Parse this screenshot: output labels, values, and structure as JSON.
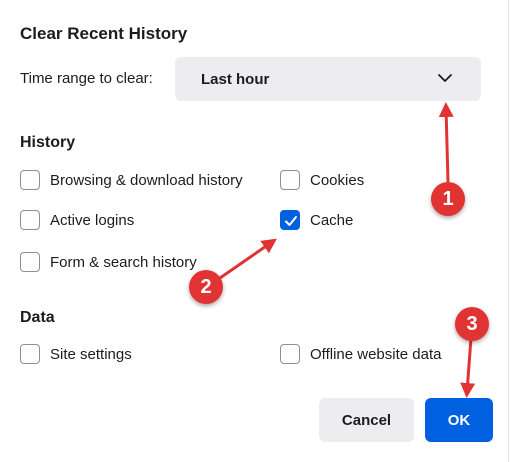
{
  "dialog": {
    "title": "Clear Recent History",
    "time_range": {
      "label": "Time range to clear:",
      "selected": "Last hour",
      "icon": "chevron-down-icon"
    },
    "history": {
      "heading": "History",
      "options": [
        {
          "label": "Browsing & download history",
          "checked": false
        },
        {
          "label": "Cookies",
          "checked": false
        },
        {
          "label": "Active logins",
          "checked": false
        },
        {
          "label": "Cache",
          "checked": true
        },
        {
          "label": "Form & search history",
          "checked": false
        }
      ]
    },
    "data": {
      "heading": "Data",
      "options": [
        {
          "label": "Site settings",
          "checked": false
        },
        {
          "label": "Offline website data",
          "checked": false
        }
      ]
    },
    "buttons": {
      "cancel": "Cancel",
      "ok": "OK"
    }
  },
  "annotations": {
    "badges": [
      "1",
      "2",
      "3"
    ],
    "color": "#e23333"
  },
  "colors": {
    "accent": "#0061e0",
    "select_bg": "#ededf0",
    "text": "#1c1b22"
  }
}
